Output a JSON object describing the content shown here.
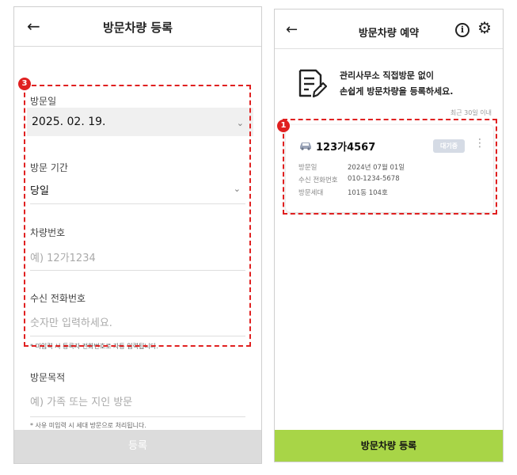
{
  "left": {
    "title": "방문차량 등록",
    "back_glyph": "←",
    "visit_date": {
      "label": "방문일",
      "value": "2025. 02. 19."
    },
    "visit_period": {
      "label": "방문 기간",
      "value": "당일"
    },
    "car_number": {
      "label": "차량번호",
      "placeholder": "예) 12가1234"
    },
    "phone": {
      "label": "수신 전화번호",
      "placeholder": "숫자만 입력하세요."
    },
    "phone_note": "* 미입력 시 등록자 전화번호로 자동 입력됩니다.",
    "purpose": {
      "label": "방문목적",
      "placeholder": "예) 가족 또는 지인 방문"
    },
    "purpose_note": "* 사유 미입력 시 세대 방문으로 처리됩니다.",
    "submit_label": "등록",
    "badge": "3"
  },
  "right": {
    "title": "방문차량 예약",
    "back_glyph": "←",
    "intro_line1": "관리사무소 직접방문 없이",
    "intro_line2": "손쉽게 방문차량을 등록하세요.",
    "recent_label": "최근 30일 이내",
    "card": {
      "plate": "123가4567",
      "status": "대기중",
      "rows": [
        {
          "key": "방문일",
          "value": "2024년 07월 01일"
        },
        {
          "key": "수신 전화번호",
          "value": "010-1234-5678"
        },
        {
          "key": "방문세대",
          "value": "101동 104호"
        }
      ]
    },
    "primary_label": "방문차량 등록",
    "badge": "1"
  },
  "colors": {
    "accent_green": "#a8d547",
    "highlight_red": "#e02020",
    "status_bg": "#d5dbe5"
  },
  "icons": [
    "back-arrow-icon",
    "chevron-down-icon",
    "info-icon",
    "gear-icon",
    "document-pen-icon",
    "car-icon",
    "kebab-menu-icon"
  ]
}
